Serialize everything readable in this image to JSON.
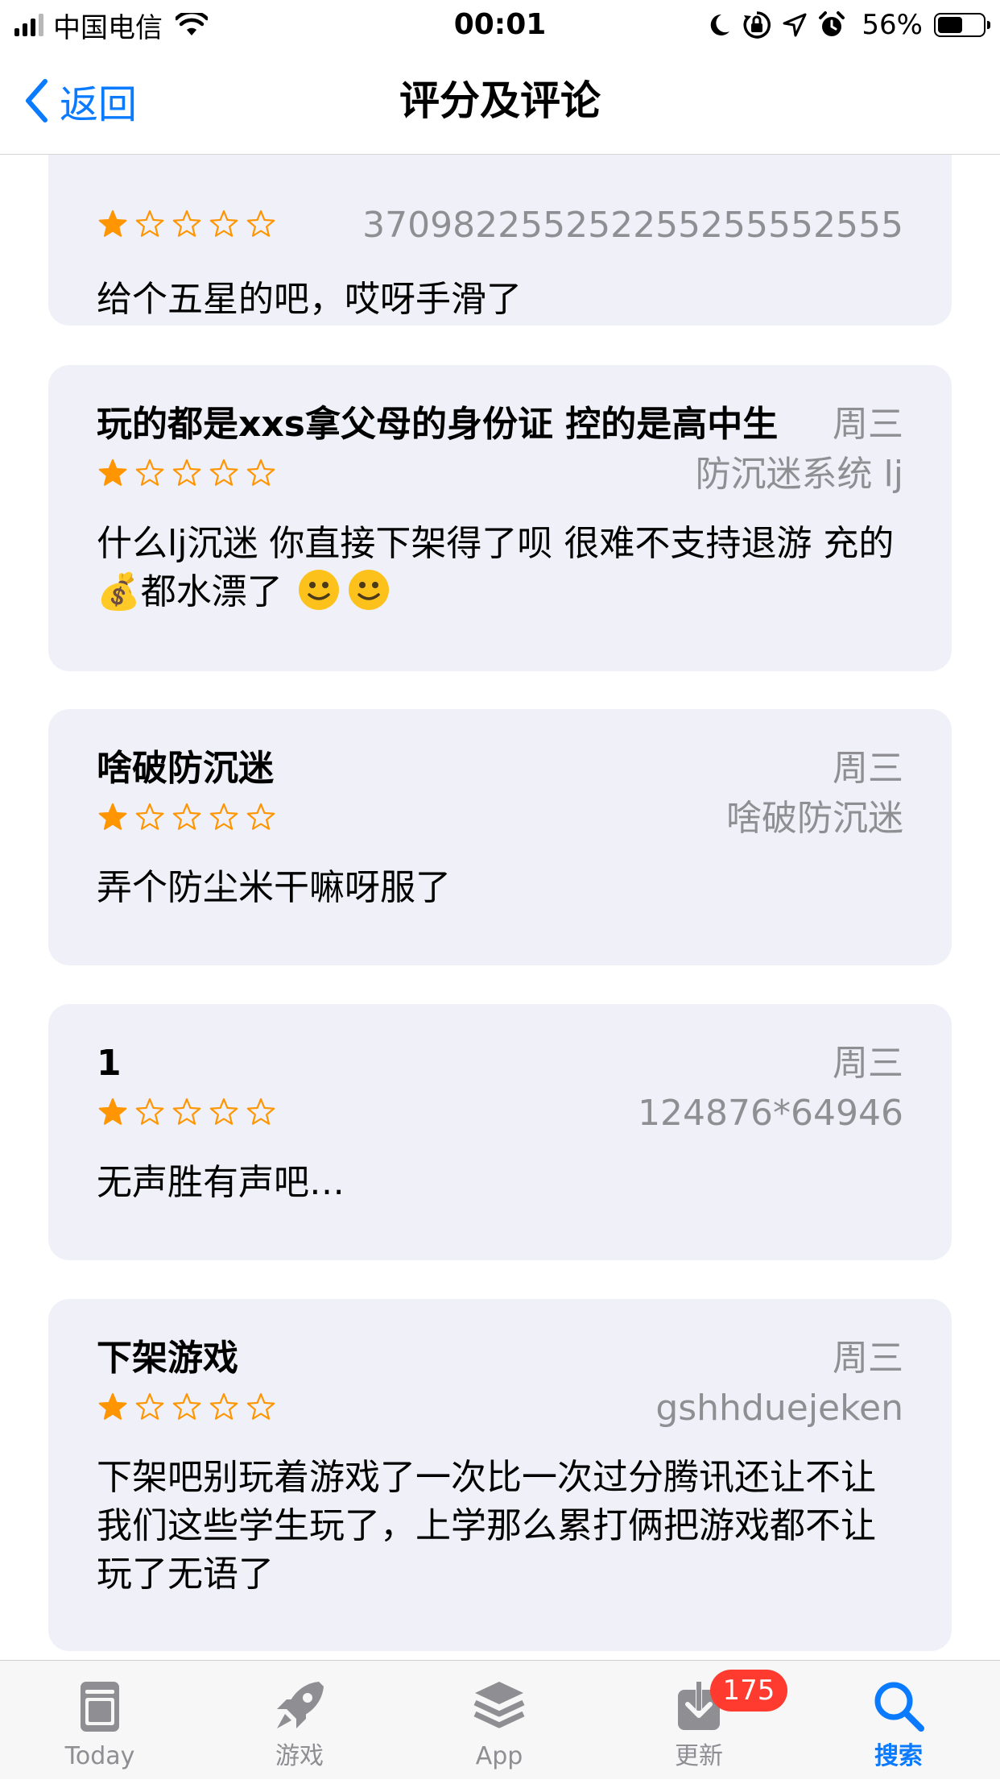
{
  "status_bar": {
    "carrier": "中国电信",
    "time": "00:01",
    "battery_percent": "56%",
    "battery_level": 0.56,
    "icons": [
      "signal-icon",
      "wifi-icon",
      "moon-icon",
      "orientation-lock-icon",
      "location-icon",
      "alarm-icon",
      "battery-icon"
    ]
  },
  "nav": {
    "back_label": "返回",
    "title": "评分及评论"
  },
  "reviews": [
    {
      "title": "",
      "date": "",
      "rating": 1,
      "author": "370982255252255255552555",
      "body": "给个五星的吧，哎呀手滑了"
    },
    {
      "title": "玩的都是xxs拿父母的身份证 控的是高中生",
      "date": "周三",
      "rating": 1,
      "author": "防沉迷系统 lj",
      "body_part1": "什么lj沉迷 你直接下架得了呗 很难不支持退游 充的",
      "body_emoji1": "💰",
      "body_part2": "都水漂了"
    },
    {
      "title": "啥破防沉迷",
      "date": "周三",
      "rating": 1,
      "author": "啥破防沉迷",
      "body": "弄个防尘米干嘛呀服了"
    },
    {
      "title": "1",
      "date": "周三",
      "rating": 1,
      "author": "124876*64946",
      "body": "无声胜有声吧…"
    },
    {
      "title": "下架游戏",
      "date": "周三",
      "rating": 1,
      "author": "gshhduejeken",
      "body": "下架吧别玩着游戏了一次比一次过分腾讯还让不让我们这些学生玩了，上学那么累打俩把游戏都不让玩了无语了"
    }
  ],
  "tab_bar": {
    "tabs": [
      {
        "label": "Today",
        "icon": "today-icon"
      },
      {
        "label": "游戏",
        "icon": "rocket-icon"
      },
      {
        "label": "App",
        "icon": "app-stack-icon"
      },
      {
        "label": "更新",
        "icon": "download-icon"
      },
      {
        "label": "搜索",
        "icon": "search-icon"
      }
    ],
    "active": "搜索",
    "updates_badge": "175"
  },
  "colors": {
    "accent": "#0a7aff",
    "star": "#ff9500",
    "card_bg": "#f0f0f8",
    "secondary_text": "#8e8e93",
    "badge": "#ff3b30"
  }
}
